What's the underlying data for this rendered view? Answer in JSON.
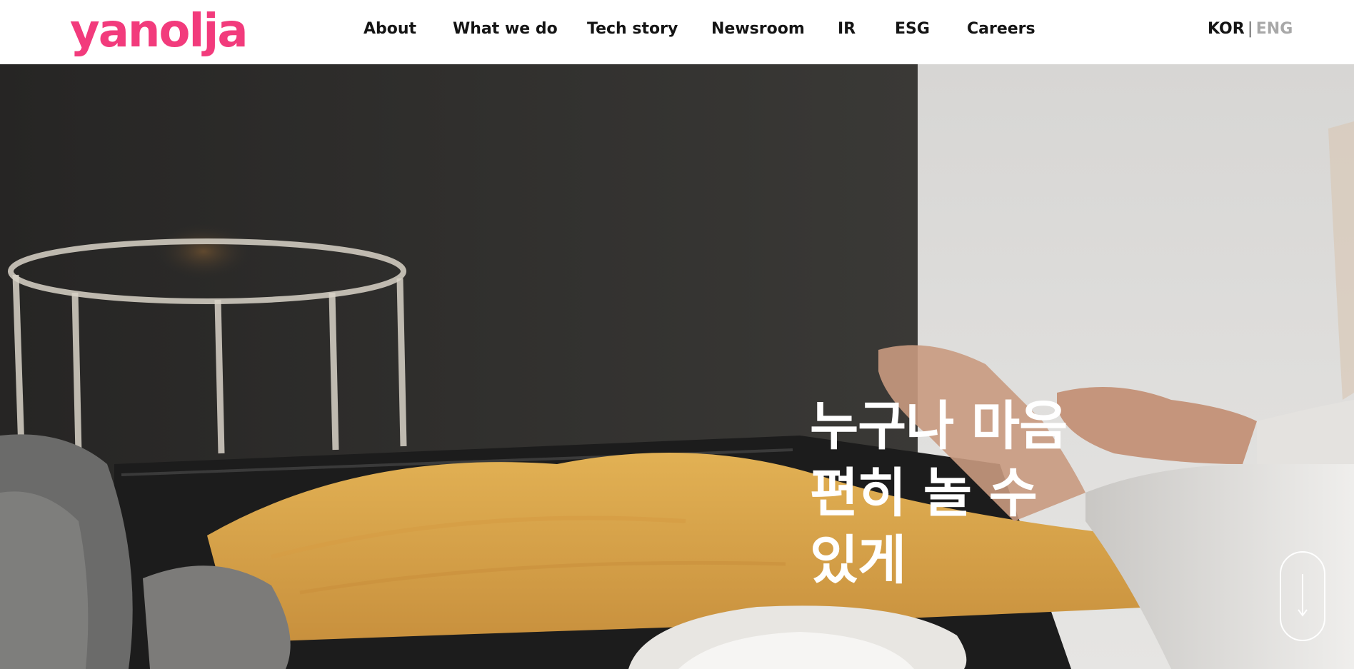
{
  "header": {
    "logo": "yanolja",
    "nav": [
      {
        "label": "About"
      },
      {
        "label": "What we do"
      },
      {
        "label": "Tech story"
      },
      {
        "label": "Newsroom"
      },
      {
        "label": "IR"
      },
      {
        "label": "ESG"
      },
      {
        "label": "Careers"
      }
    ],
    "lang": {
      "kor": "KOR",
      "separator": "|",
      "eng": "ENG"
    }
  },
  "hero": {
    "headline_lines": [
      "누구나 마음",
      "편히 놀 수",
      "있게"
    ],
    "scroll_icon": "arrow-down-icon"
  },
  "colors": {
    "brand": "#f23b7c",
    "nav_text": "#141414",
    "lang_inactive": "#a8a8a8"
  }
}
